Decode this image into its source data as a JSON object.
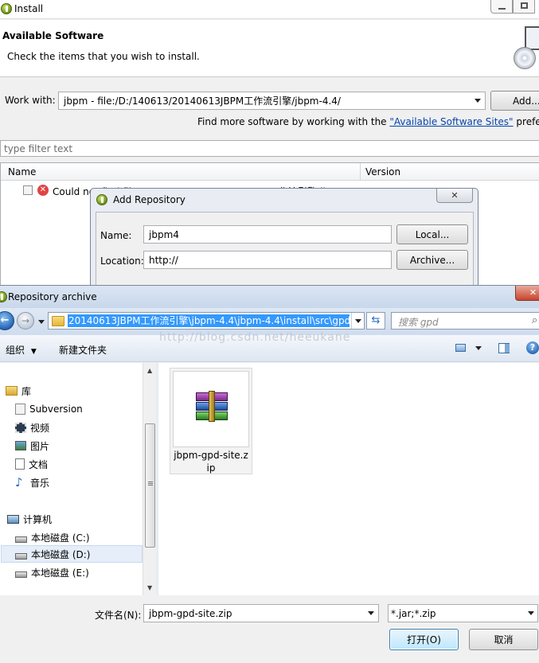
{
  "install": {
    "title": "Install",
    "header_title": "Available Software",
    "header_subtitle": "Check the items that you wish to install.",
    "work_with_label": "Work with:",
    "work_with_value": "jbpm - file:/D:/140613/20140613JBPM工作流引擎/jbpm-4.4/",
    "add_button": "Add...",
    "find_more_text": "Find more software by working with the",
    "sites_link": "\"Available Software Sites\"",
    "prefs_text": "prefere",
    "filter_placeholder": "type filter text",
    "col_name": "Name",
    "col_version": "Version",
    "row_text": "Could not find file:/D:/140613/20140613JBPM工作流引擎/jbpm-4.4/"
  },
  "add_repo": {
    "title": "Add Repository",
    "name_label": "Name:",
    "name_value": "jbpm4",
    "local_button": "Local...",
    "location_label": "Location:",
    "location_value": "http://",
    "archive_button": "Archive..."
  },
  "archive": {
    "title": "Repository archive",
    "address": "20140613JBPM工作流引擎\\jbpm-4.4\\jbpm-4.4\\install\\src\\gpd",
    "search_placeholder": "搜索 gpd",
    "organize": "组织",
    "new_folder": "新建文件夹",
    "watermark": "http://blog.csdn.net/heeukane",
    "sidebar": {
      "library": "库",
      "items": [
        "Subversion",
        "视频",
        "图片",
        "文档",
        "音乐"
      ],
      "computer": "计算机",
      "drives": [
        "本地磁盘 (C:)",
        "本地磁盘 (D:)",
        "本地磁盘 (E:)"
      ]
    },
    "file_name_line1": "jbpm-gpd-site.z",
    "file_name_line2": "ip",
    "filename_label": "文件名(N):",
    "filename_value": "jbpm-gpd-site.zip",
    "filter_value": "*.jar;*.zip",
    "open_button": "打开(O)",
    "cancel_button": "取消"
  },
  "colors": {
    "selection": "#3399ff",
    "link": "#0645ad",
    "hover_row": "#dbe8f7"
  }
}
